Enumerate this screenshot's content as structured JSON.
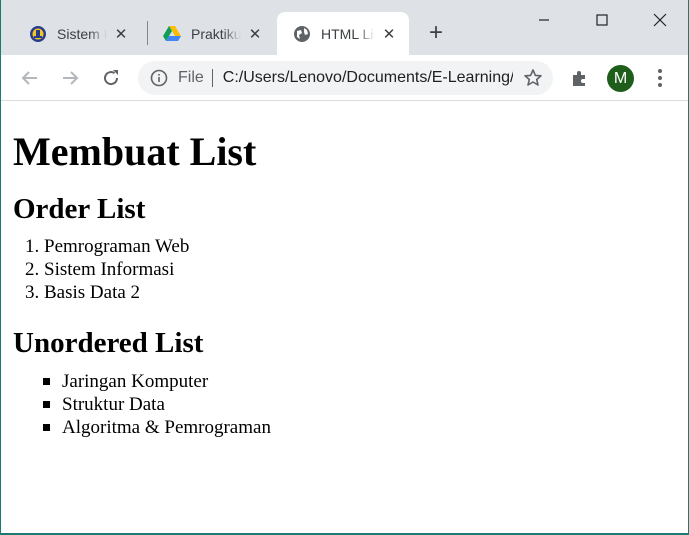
{
  "browser": {
    "tabs": [
      {
        "title": "Sistem Informasi",
        "close": "✕"
      },
      {
        "title": "Praktikum",
        "close": "✕"
      },
      {
        "title": "HTML List",
        "close": "✕"
      }
    ],
    "new_tab": "+",
    "omnibox": {
      "scheme": "File",
      "url": "C:/Users/Lenovo/Documents/E-Learning/list.html"
    },
    "profile_initial": "M"
  },
  "page": {
    "heading": "Membuat List",
    "ordered_title": "Order List",
    "ordered_items": [
      "Pemrograman Web",
      "Sistem Informasi",
      "Basis Data 2"
    ],
    "unordered_title": "Unordered List",
    "unordered_items": [
      "Jaringan Komputer",
      "Struktur Data",
      "Algoritma & Pemrograman"
    ]
  }
}
